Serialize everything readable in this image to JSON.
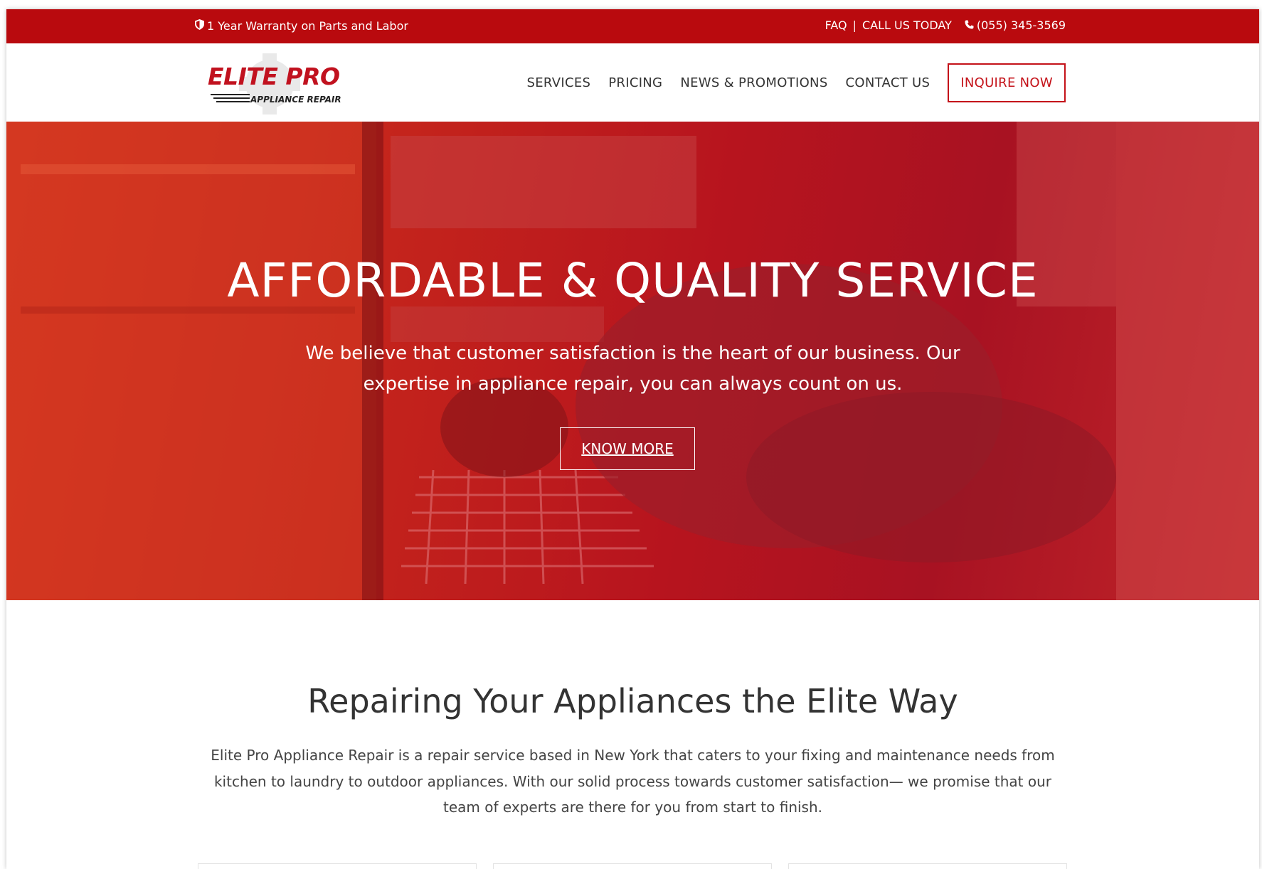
{
  "topbar": {
    "warranty_text": "1 Year Warranty on Parts and Labor",
    "faq_label": "FAQ",
    "separator": "|",
    "call_label": "CALL US TODAY",
    "phone": "(055) 345-3569"
  },
  "header": {
    "logo": {
      "line1": "ELITE PRO",
      "line2": "APPLIANCE REPAIR"
    },
    "nav": {
      "services": "SERVICES",
      "pricing": "PRICING",
      "news": "NEWS & PROMOTIONS",
      "contact": "CONTACT US",
      "inquire": "INQUIRE NOW"
    }
  },
  "hero": {
    "title": "AFFORDABLE & QUALITY SERVICE",
    "subtitle": "We believe that customer satisfaction is the heart of our business. Our expertise in appliance repair, you can always count on us.",
    "cta": "KNOW MORE"
  },
  "about": {
    "heading": "Repairing Your Appliances the Elite Way",
    "body": "Elite Pro Appliance Repair is a repair service based in New York that caters to your fixing and maintenance needs from kitchen to laundry to outdoor appliances. With our solid process towards customer satisfaction— we promise that our team of experts are there for you from start to finish."
  },
  "colors": {
    "brand_red": "#b90a0e",
    "accent_red": "#c41219",
    "text_dark": "#333333"
  },
  "icons": {
    "warranty": "shield-icon",
    "phone": "phone-icon"
  }
}
